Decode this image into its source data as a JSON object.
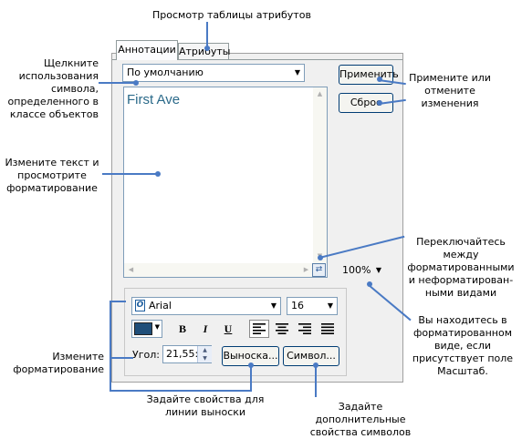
{
  "callouts": {
    "attr_table": "Просмотр таблицы атрибутов",
    "click_symbol": [
      "Щелкните",
      "использования",
      "символа,",
      "определенного в",
      "классе объектов"
    ],
    "apply_reset": [
      "Примените или",
      "отмените",
      "изменения"
    ],
    "edit_text": [
      "Измените текст и",
      "просмотрите",
      "форматирование"
    ],
    "toggle_views": [
      "Переключайтесь",
      "между",
      "форматированными",
      "и неформатирован-",
      "ными видами"
    ],
    "formatted_view": [
      "Вы находитесь в",
      "форматированном",
      "виде, если",
      "присутствует поле",
      "Масштаб."
    ],
    "change_format": [
      "Измените",
      "форматирование"
    ],
    "leader_props": [
      "Задайте свойства для",
      "линии выноски"
    ],
    "more_symbol_props": [
      "Задайте дополнительные",
      "свойства символов"
    ]
  },
  "tabs": {
    "annotations": "Аннотации",
    "attributes": "Атрибуты"
  },
  "symbol_dropdown": {
    "value": "По умолчанию"
  },
  "buttons": {
    "apply": "Применить",
    "reset": "Сброс",
    "leader": "Выноска...",
    "symbol": "Символ..."
  },
  "text_area": {
    "value": "First Ave",
    "color": "#2b6a8a"
  },
  "zoom": {
    "value": "100%"
  },
  "font": {
    "name": "Arial",
    "size": "16"
  },
  "style_buttons": {
    "bold": "B",
    "italic": "I",
    "underline": "U"
  },
  "angle": {
    "label": "Угол:",
    "value": "21,55:"
  },
  "colors": {
    "callout_line": "#4a7ac4",
    "swatch": "#1f4e79",
    "font_icon": "#1f5f9f"
  }
}
